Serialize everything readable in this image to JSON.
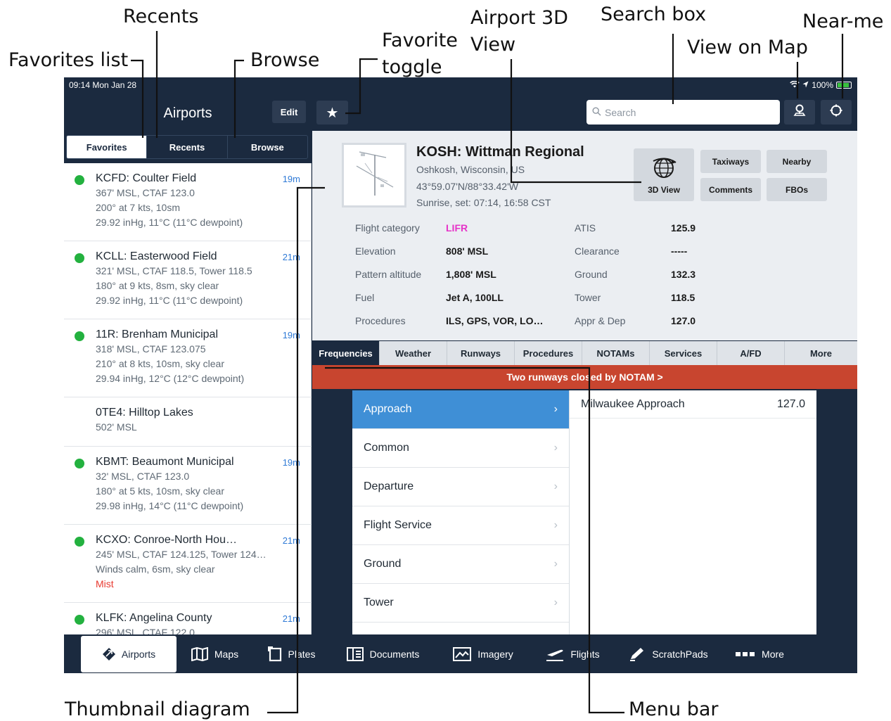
{
  "callouts": {
    "favorites_list": "Favorites list",
    "recents": "Recents",
    "browse": "Browse",
    "favorite_toggle_1": "Favorite",
    "favorite_toggle_2": "toggle",
    "airport_3d_1": "Airport 3D",
    "airport_3d_2": "View",
    "search_box": "Search box",
    "view_on_map": "View on Map",
    "near_me": "Near-me",
    "thumbnail_diagram": "Thumbnail diagram",
    "menu_bar": "Menu bar"
  },
  "status_bar": {
    "time": "09:14  Mon Jan 28",
    "battery": "100%"
  },
  "left_panel": {
    "title": "Airports",
    "edit_label": "Edit",
    "segments": [
      "Favorites",
      "Recents",
      "Browse"
    ],
    "airports": [
      {
        "name": "KCFD: Coulter Field",
        "age": "19m",
        "lines": [
          "367' MSL, CTAF 123.0",
          "200° at 7 kts, 10sm",
          "29.92 inHg, 11°C (11°C dewpoint)"
        ],
        "warning": ""
      },
      {
        "name": "KCLL: Easterwood Field",
        "age": "21m",
        "lines": [
          "321' MSL, CTAF 118.5, Tower 118.5",
          "180° at 9 kts, 8sm, sky clear",
          "29.92 inHg, 11°C (11°C dewpoint)"
        ],
        "warning": ""
      },
      {
        "name": "11R: Brenham Municipal",
        "age": "19m",
        "lines": [
          "318' MSL, CTAF 123.075",
          "210° at 8 kts, 10sm, sky clear",
          "29.94 inHg, 12°C (12°C dewpoint)"
        ],
        "warning": ""
      },
      {
        "name": "0TE4: Hilltop Lakes",
        "age": "",
        "lines": [
          "502' MSL"
        ],
        "warning": ""
      },
      {
        "name": "KBMT: Beaumont Municipal",
        "age": "19m",
        "lines": [
          "32' MSL, CTAF 123.0",
          "180° at 5 kts, 10sm, sky clear",
          "29.98 inHg, 14°C (11°C dewpoint)"
        ],
        "warning": ""
      },
      {
        "name": "KCXO: Conroe-North Hou…",
        "age": "21m",
        "lines": [
          "245' MSL, CTAF 124.125, Tower 124…",
          "Winds calm, 6sm, sky clear"
        ],
        "warning": "Mist"
      },
      {
        "name": "KLFK: Angelina County",
        "age": "21m",
        "lines": [
          "296' MSL, CTAF 122.0"
        ],
        "warning": ""
      }
    ]
  },
  "search": {
    "placeholder": "Search"
  },
  "airport": {
    "title": "KOSH: Wittman Regional",
    "location": "Oshkosh, Wisconsin, US",
    "coords": "43°59.07'N/88°33.42'W",
    "sun": "Sunrise, set: 07:14, 16:58 CST",
    "view3d_label": "3D View",
    "buttons": [
      "Taxiways",
      "Nearby",
      "Comments",
      "FBOs"
    ],
    "left_facts": [
      {
        "key": "Flight category",
        "value": "LIFR"
      },
      {
        "key": "Elevation",
        "value": "808' MSL"
      },
      {
        "key": "Pattern altitude",
        "value": "1,808' MSL"
      },
      {
        "key": "Fuel",
        "value": "Jet A, 100LL"
      },
      {
        "key": "Procedures",
        "value": "ILS, GPS, VOR, LO…"
      }
    ],
    "right_facts": [
      {
        "key": "ATIS",
        "value": "125.9"
      },
      {
        "key": "Clearance",
        "value": "-----"
      },
      {
        "key": "Ground",
        "value": "132.3"
      },
      {
        "key": "Tower",
        "value": "118.5"
      },
      {
        "key": "Appr & Dep",
        "value": "127.0"
      }
    ],
    "flight_category_color": "#e633c8"
  },
  "tabs": [
    "Frequencies",
    "Weather",
    "Runways",
    "Procedures",
    "NOTAMs",
    "Services",
    "A/FD",
    "More"
  ],
  "notam_banner": "Two runways closed by NOTAM >",
  "freq_categories": [
    "Approach",
    "Common",
    "Departure",
    "Flight Service",
    "Ground",
    "Tower"
  ],
  "freq_detail": [
    {
      "name": "Milwaukee Approach",
      "freq": "127.0"
    }
  ],
  "bottom_bar": [
    "Airports",
    "Maps",
    "Plates",
    "Documents",
    "Imagery",
    "Flights",
    "ScratchPads",
    "More"
  ],
  "colors": {
    "navy": "#1b2a3f",
    "accent_blue": "#3f8fd6",
    "notam_red": "#c8452f",
    "status_green": "#23b13f",
    "age_blue": "#2f7ad6",
    "warning_red": "#e8392f"
  }
}
